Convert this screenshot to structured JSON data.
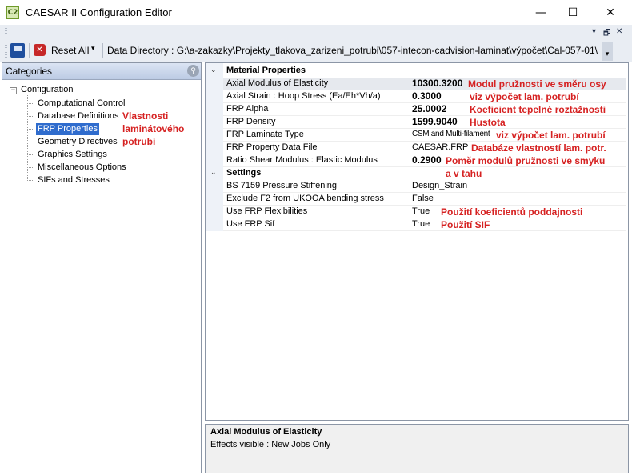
{
  "window": {
    "icon_text": "C2",
    "title": "CAESAR II Configuration Editor",
    "controls": {
      "minimize": "—",
      "maximize": "☐",
      "close": "✕"
    }
  },
  "mdi_controls": {
    "pin": "▾",
    "restore": "🗗",
    "close": "✕"
  },
  "toolbar": {
    "reset_label": "Reset All",
    "reset_caret": "▾",
    "data_directory": "Data Directory : G:\\a-zakazky\\Projekty_tlakova_zarizeni_potrubi\\057-intecon-cadvision-laminat\\výpočet\\Cal-057-01\\",
    "overflow": "▾"
  },
  "categories": {
    "title": "Categories",
    "root_toggle": "−",
    "root_label": "Configuration",
    "items": [
      {
        "label": "Computational Control",
        "selected": false
      },
      {
        "label": "Database Definitions",
        "selected": false
      },
      {
        "label": "FRP Properties",
        "selected": true
      },
      {
        "label": "Geometry Directives",
        "selected": false
      },
      {
        "label": "Graphics Settings",
        "selected": false
      },
      {
        "label": "Miscellaneous Options",
        "selected": false
      },
      {
        "label": "SIFs and Stresses",
        "selected": false
      }
    ],
    "note_line1": "Vlastnosti",
    "note_line2": "laminátového",
    "note_line3": "potrubí"
  },
  "grid": {
    "material": {
      "toggle": "⌄",
      "label": "Material Properties",
      "rows": [
        {
          "name": "Axial Modulus of Elasticity",
          "value": "10300.3200",
          "note": "Modul pružnosti ve směru osy"
        },
        {
          "name": "Axial Strain : Hoop Stress (Ea/Eh*Vh/a)",
          "value": "0.3000",
          "note": "viz výpočet lam. potrubí"
        },
        {
          "name": "FRP Alpha",
          "value": "25.0002",
          "note": "Koeficient tepelné roztažnosti"
        },
        {
          "name": "FRP Density",
          "value": "1599.9040",
          "note": "Hustota"
        },
        {
          "name": "FRP Laminate Type",
          "value": "CSM and Multi-filament",
          "note": "viz výpočet lam. potrubí"
        },
        {
          "name": "FRP Property Data File",
          "value": "CAESAR.FRP",
          "note": "Databáze vlastností lam. potr."
        },
        {
          "name": "Ratio Shear Modulus : Elastic Modulus",
          "value": "0.2900",
          "note": "Poměr modulů pružnosti ve smyku"
        }
      ],
      "note_extra": "a v tahu"
    },
    "settings": {
      "toggle": "⌄",
      "label": "Settings",
      "rows": [
        {
          "name": "BS 7159 Pressure Stiffening",
          "value": "Design_Strain",
          "note": ""
        },
        {
          "name": "Exclude F2 from UKOOA bending stress",
          "value": "False",
          "note": ""
        },
        {
          "name": "Use FRP Flexibilities",
          "value": "True",
          "note": "Použití koeficientů poddajnosti"
        },
        {
          "name": "Use FRP Sif",
          "value": "True",
          "note": "Použití SIF"
        }
      ]
    }
  },
  "description": {
    "title": "Axial Modulus of Elasticity",
    "text": "Effects visible : New Jobs Only"
  }
}
